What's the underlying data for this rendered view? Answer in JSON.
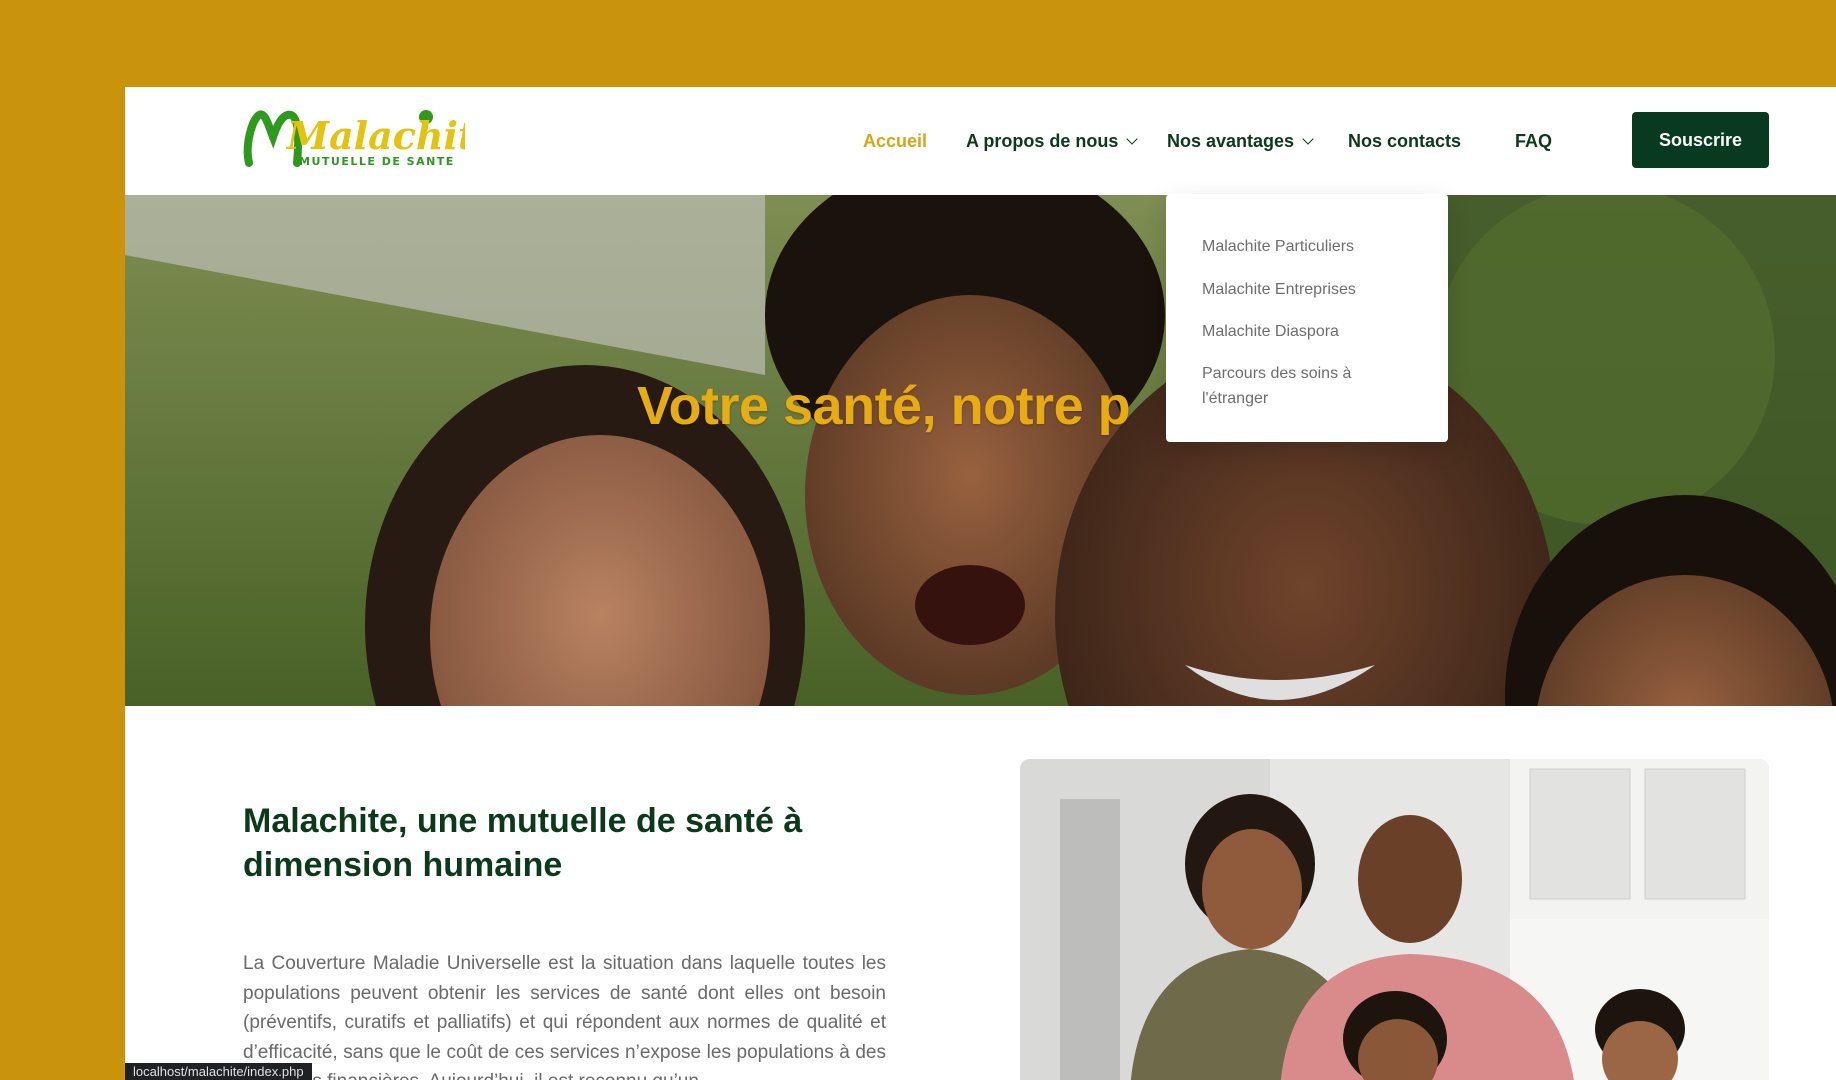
{
  "brand": {
    "logo_main": "Malachite",
    "logo_sub": "MUTUELLE DE SANTE"
  },
  "nav": {
    "items": [
      {
        "label": "Accueil",
        "active": true,
        "has_dropdown": false
      },
      {
        "label": "A propos de nous",
        "active": false,
        "has_dropdown": true
      },
      {
        "label": "Nos avantages",
        "active": false,
        "has_dropdown": true
      },
      {
        "label": "Nos contacts",
        "active": false,
        "has_dropdown": false
      },
      {
        "label": "FAQ",
        "active": false,
        "has_dropdown": false
      }
    ],
    "cta_label": "Souscrire"
  },
  "dropdown": {
    "items": [
      "Malachite Particuliers",
      "Malachite Entreprises",
      "Malachite Diaspora",
      "Parcours des soins à l'étranger"
    ]
  },
  "hero": {
    "title": "Votre santé, notre p"
  },
  "intro": {
    "title": "Malachite, une mutuelle de santé à dimension humaine",
    "text": "La Couverture Maladie Universelle est la situation dans laquelle toutes les populations peuvent obtenir les services de santé dont elles ont besoin (préventifs, curatifs et palliatifs) et qui répondent aux normes de qualité et d’efficacité, sans que le coût de ces services n’expose les populations à des difficultés financières. Aujourd’hui, il est reconnu qu’un"
  },
  "status_url": "localhost/malachite/index.php",
  "colors": {
    "frame": "#c9930c",
    "accent_gold": "#d9a515",
    "brand_green": "#0b3a1b",
    "cta_green": "#083a20",
    "logo_green": "#2e9a1d",
    "logo_yellow": "#e5c20d"
  }
}
